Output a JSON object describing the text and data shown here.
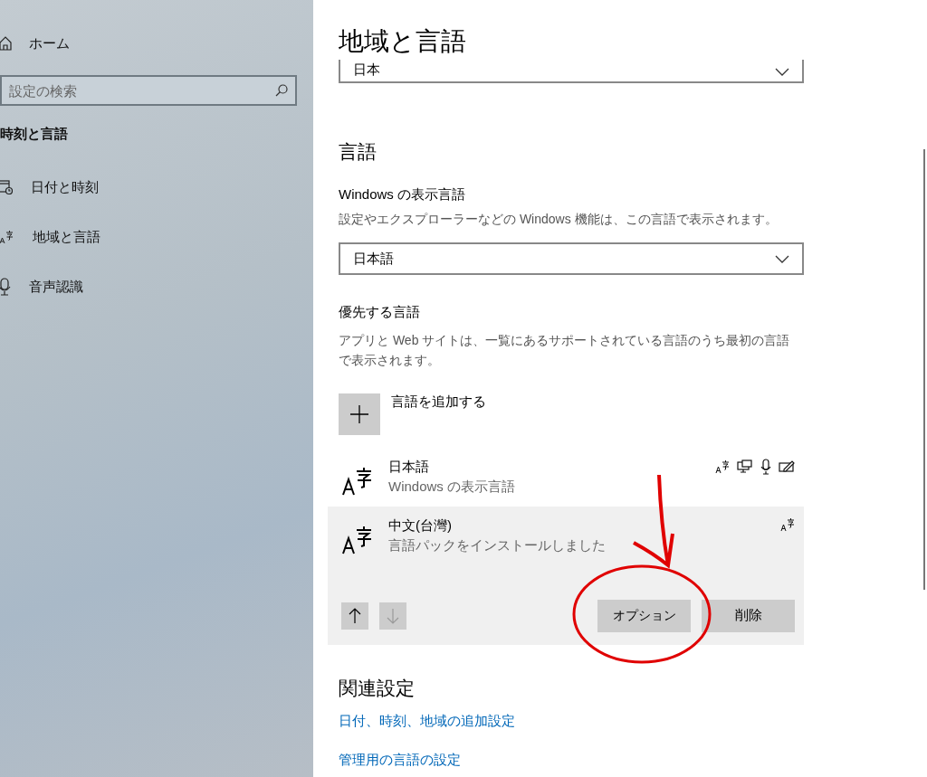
{
  "sidebar": {
    "home": "ホーム",
    "search": {
      "placeholder": "設定の検索"
    },
    "section_title": "時刻と言語",
    "items": [
      {
        "label": "日付と時刻"
      },
      {
        "label": "地域と言語"
      },
      {
        "label": "音声認識"
      }
    ]
  },
  "main": {
    "title": "地域と言語",
    "region_dropdown": {
      "value": "日本"
    },
    "language_heading": "言語",
    "display_language": {
      "label": "Windows の表示言語",
      "description": "設定やエクスプローラーなどの Windows 機能は、この言語で表示されます。",
      "value": "日本語"
    },
    "preferred": {
      "label": "優先する言語",
      "description": "アプリと Web サイトは、一覧にあるサポートされている言語のうち最初の言語で表示されます。",
      "add_button": "言語を追加する",
      "languages": [
        {
          "name": "日本語",
          "status": "Windows の表示言語",
          "selected": false,
          "features": [
            {
              "kind": "language"
            },
            {
              "kind": "display"
            },
            {
              "kind": "speech"
            },
            {
              "kind": "handwriting"
            }
          ]
        },
        {
          "name": "中文(台灣)",
          "status": "言語パックをインストールしました",
          "selected": true,
          "features": [
            {
              "kind": "language"
            }
          ],
          "up_disabled": false,
          "down_disabled": true,
          "options_button": "オプション",
          "remove_button": "削除"
        }
      ]
    },
    "related_heading": "関連設定",
    "links": [
      "日付、時刻、地域の追加設定",
      "管理用の言語の設定"
    ]
  }
}
